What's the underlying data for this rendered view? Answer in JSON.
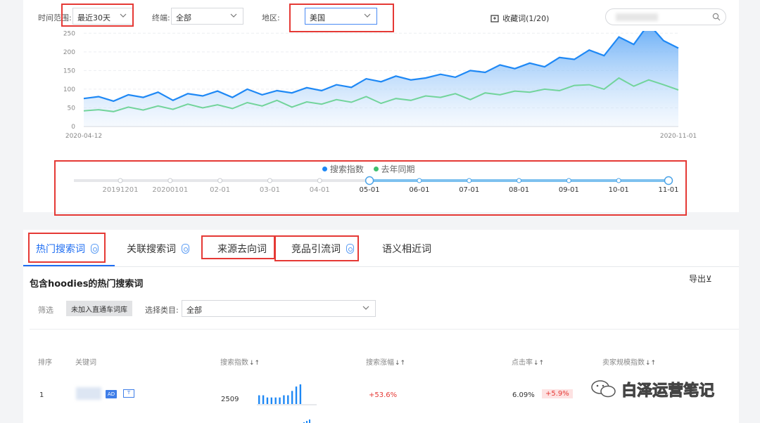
{
  "filters": {
    "time_label": "时间范围:",
    "time_value": "最近30天",
    "terminal_label": "终端:",
    "terminal_value": "全部",
    "region_label": "地区:",
    "region_value": "美国",
    "favorites_label": "收藏词(1/20)"
  },
  "chart_data": {
    "type": "area",
    "x_start": "2020-04-12",
    "x_end": "2020-11-01",
    "yticks": [
      "250",
      "200",
      "150",
      "100",
      "50",
      "0"
    ],
    "ylim": [
      0,
      260
    ],
    "series": [
      {
        "name": "搜索指数",
        "color": "#1e88f5",
        "values": [
          75,
          80,
          68,
          85,
          78,
          92,
          70,
          88,
          82,
          95,
          78,
          100,
          85,
          96,
          90,
          104,
          96,
          112,
          105,
          128,
          120,
          135,
          125,
          130,
          140,
          132,
          150,
          145,
          165,
          155,
          170,
          160,
          185,
          180,
          205,
          190,
          240,
          220,
          275,
          230,
          210
        ]
      },
      {
        "name": "去年同期",
        "color": "#72d49b",
        "values": [
          42,
          45,
          40,
          52,
          44,
          55,
          46,
          60,
          50,
          58,
          48,
          64,
          55,
          70,
          52,
          66,
          60,
          72,
          65,
          80,
          62,
          75,
          70,
          82,
          78,
          88,
          72,
          90,
          85,
          95,
          92,
          100,
          96,
          110,
          112,
          100,
          130,
          108,
          125,
          112,
          98
        ]
      }
    ],
    "legend": [
      "搜索指数",
      "去年同期"
    ]
  },
  "timeline": {
    "labels": [
      "20191201",
      "20200101",
      "02-01",
      "03-01",
      "04-01",
      "05-01",
      "06-01",
      "07-01",
      "08-01",
      "09-01",
      "10-01",
      "11-01"
    ],
    "active_from": 5
  },
  "tabs": [
    "热门搜索词",
    "关联搜索词",
    "来源去向词",
    "竞品引流词",
    "语义相近词"
  ],
  "section": {
    "title": "包含hoodies的热门搜索词",
    "export": "导出⊻",
    "filter_label": "筛选",
    "filter_chip": "未加入直通车词库",
    "category_label": "选择类目:",
    "category_value": "全部"
  },
  "table": {
    "headers": [
      "排序",
      "关键词",
      "搜索指数",
      "搜索涨幅",
      "点击率",
      "卖家规模指数"
    ],
    "row": {
      "rank": "1",
      "badge_ad": "AD",
      "badge_t": "T",
      "search_index": "2509",
      "growth": "+53.6%",
      "ctr": "6.09%",
      "ctr_change": "+5.9%",
      "sparkline": [
        4,
        4,
        3,
        3,
        3,
        3,
        4,
        4,
        6,
        8,
        9
      ]
    }
  },
  "watermark": "白泽运营笔记"
}
